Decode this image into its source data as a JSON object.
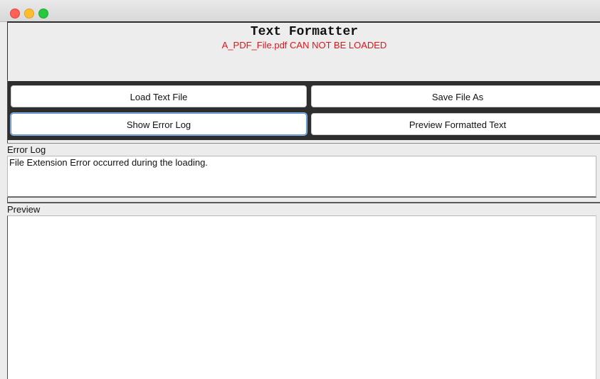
{
  "window": {
    "controls": [
      "close",
      "minimize",
      "maximize"
    ],
    "colors": {
      "close": "#fe5f57",
      "minimize": "#febc2e",
      "maximize": "#28c840"
    }
  },
  "header": {
    "title": "Text Formatter",
    "status_message": "A_PDF_File.pdf CAN NOT BE LOADED",
    "status_color": "#e0151b"
  },
  "buttons": {
    "load": "Load Text File",
    "save": "Save File As",
    "show_log": "Show  Error Log",
    "preview": "Preview Formatted Text"
  },
  "error_log": {
    "label": "Error Log",
    "content": "File Extension Error occurred during the loading."
  },
  "preview": {
    "label": "Preview",
    "content": ""
  }
}
